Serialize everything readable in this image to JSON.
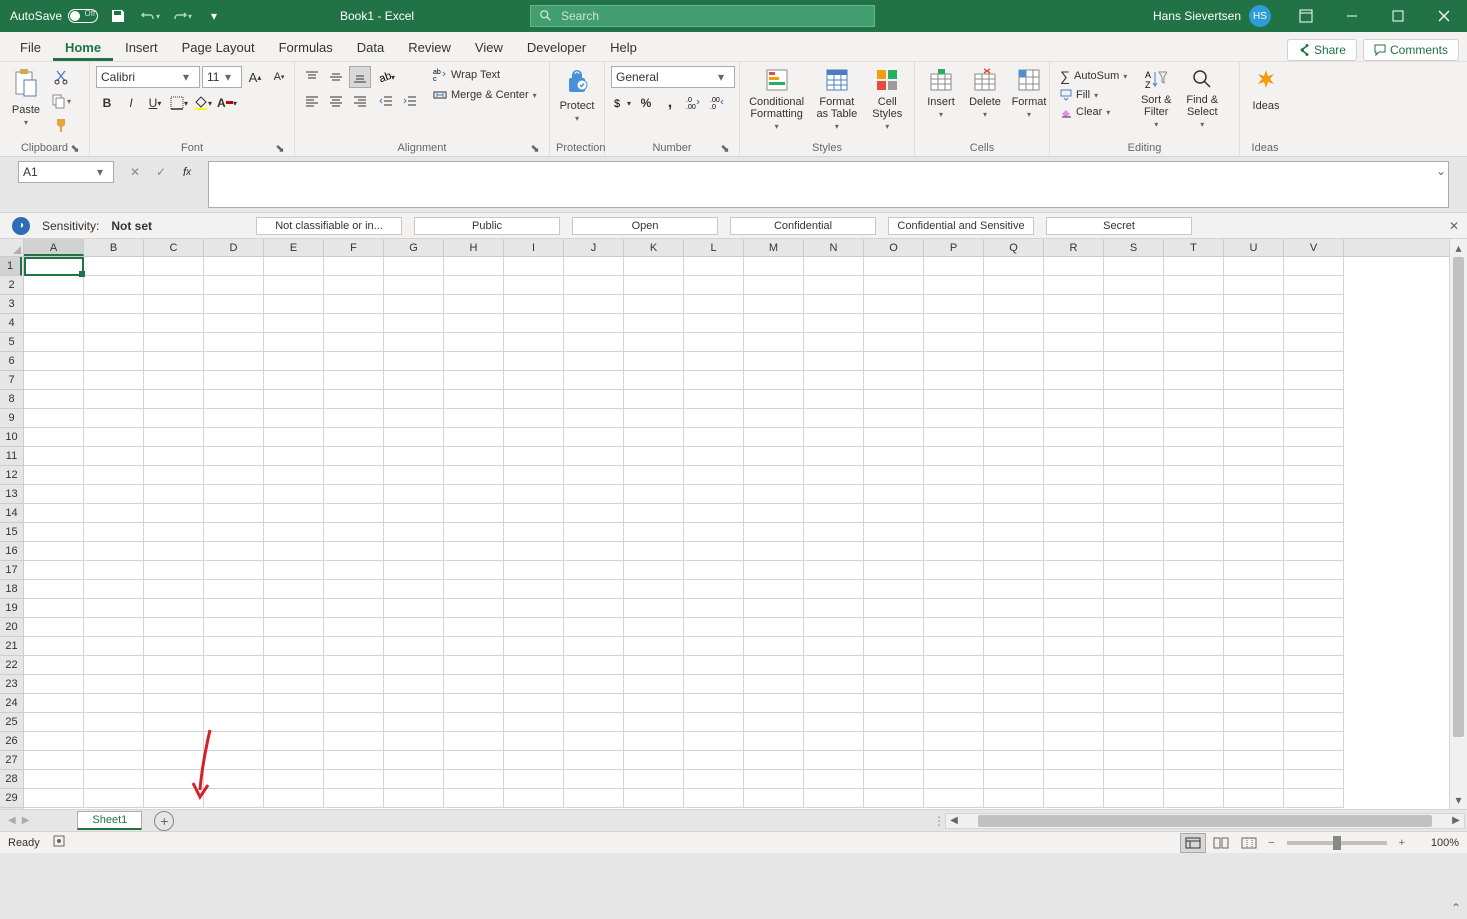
{
  "titlebar": {
    "autosave_label": "AutoSave",
    "autosave_state": "Off",
    "title": "Book1  -  Excel",
    "search_placeholder": "Search",
    "username": "Hans Sievertsen",
    "user_initials": "HS"
  },
  "menu": {
    "items": [
      "File",
      "Home",
      "Insert",
      "Page Layout",
      "Formulas",
      "Data",
      "Review",
      "View",
      "Developer",
      "Help"
    ],
    "active_index": 1,
    "share_label": "Share",
    "comments_label": "Comments"
  },
  "ribbon": {
    "clipboard": {
      "label": "Clipboard",
      "paste": "Paste"
    },
    "font": {
      "label": "Font",
      "font_name": "Calibri",
      "font_size": "11"
    },
    "alignment": {
      "label": "Alignment",
      "wrap_text": "Wrap Text",
      "merge_center": "Merge & Center"
    },
    "protection": {
      "label": "Protection",
      "protect": "Protect"
    },
    "number": {
      "label": "Number",
      "format": "General"
    },
    "styles": {
      "label": "Styles",
      "conditional": "Conditional Formatting",
      "format_table": "Format as Table",
      "cell_styles": "Cell Styles"
    },
    "cells": {
      "label": "Cells",
      "insert": "Insert",
      "delete": "Delete",
      "format": "Format"
    },
    "editing": {
      "label": "Editing",
      "autosum": "AutoSum",
      "fill": "Fill",
      "clear": "Clear",
      "sort_filter": "Sort & Filter",
      "find_select": "Find & Select"
    },
    "ideas": {
      "label": "Ideas",
      "ideas": "Ideas"
    }
  },
  "formula": {
    "name_box": "A1",
    "formula_value": ""
  },
  "sensitivity": {
    "label": "Sensitivity:",
    "value": "Not set",
    "options": [
      "Not classifiable or in...",
      "Public",
      "Open",
      "Confidential",
      "Confidential and Sensitive",
      "Secret"
    ]
  },
  "grid": {
    "columns": [
      "A",
      "B",
      "C",
      "D",
      "E",
      "F",
      "G",
      "H",
      "I",
      "J",
      "K",
      "L",
      "M",
      "N",
      "O",
      "P",
      "Q",
      "R",
      "S",
      "T",
      "U",
      "V"
    ],
    "rows": 29,
    "selected_cell": "A1"
  },
  "sheets": {
    "tabs": [
      "Sheet1"
    ],
    "active_index": 0
  },
  "statusbar": {
    "ready": "Ready",
    "zoom": "100%"
  }
}
